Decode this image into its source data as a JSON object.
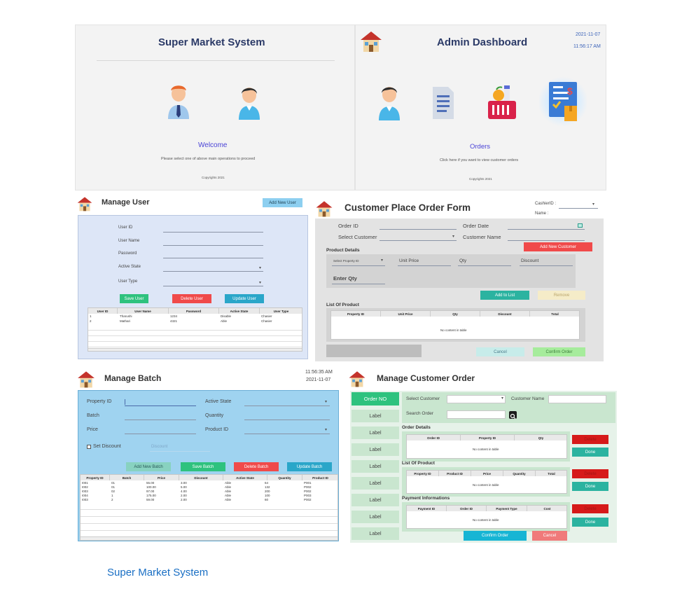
{
  "welcome": {
    "title": "Super Market System",
    "welcome_label": "Welcome",
    "instruction": "Please select one of above main operations to proceed",
    "copyright": "Copyrights 2021"
  },
  "admin": {
    "title": "Admin Dashboard",
    "date": "2021-11-07",
    "time": "11:56:17 AM",
    "orders_label": "Orders",
    "orders_hint": "Click  here if you want to view customer orders",
    "copyright": "Copyrights 2021"
  },
  "manage_user": {
    "title": "Manage User",
    "add_new_user": "Add New User",
    "fields": [
      "User ID",
      "User Name",
      "Password",
      "Active State",
      "User Type"
    ],
    "save": "Save User",
    "delete": "Delete User",
    "update": "Update User",
    "columns": [
      "User ID",
      "User Name",
      "Password",
      "Active State",
      "User Type"
    ],
    "rows": [
      [
        "1",
        "Tharushi",
        "1234",
        "Disable",
        "Chasier"
      ],
      [
        "2",
        "Mathari",
        "4321",
        "Able",
        "Chasier"
      ]
    ]
  },
  "order_form": {
    "title": "Customer Place Order Form",
    "cashier_label": "CashierID :",
    "name_label": "Name   :",
    "order_id": "Order ID",
    "order_date": "Order Date",
    "select_customer": "Select Customer",
    "customer_name": "Customer Name",
    "add_new_customer": "Add New Customer",
    "product_details": "Product Details",
    "select_property": "Select Property ID",
    "unit_price": "Unit Price",
    "qty": "Qty",
    "discount": "Discount",
    "enter_qty": "Enter Qty",
    "add_to_list": "Add to List",
    "remove": "Remove",
    "list_of_product": "List Of Product",
    "columns": [
      "Property ID",
      "Unit Price",
      "Qty",
      "Discount",
      "Total"
    ],
    "empty": "No content in table",
    "cancel": "Cancel",
    "confirm": "Confirm Order"
  },
  "manage_batch": {
    "title": "Manage Batch",
    "time": "11:56:35 AM",
    "date": "2021-11-07",
    "property_id": "Property ID",
    "active_state": "Active State",
    "batch": "Batch",
    "quantity": "Quantity",
    "price": "Price",
    "property_id2": "Product ID",
    "set_discount": "Set Discount",
    "discount_placeholder": "Discount",
    "add_new": "Add New Batch",
    "save": "Save Batch",
    "delete": "Delete Batch",
    "update": "Update Batch",
    "columns": [
      "Property ID",
      "Batch",
      "Price",
      "Discount",
      "Active State",
      "Quantity",
      "Product ID"
    ],
    "rows": [
      [
        "I001",
        "01",
        "55.00",
        "3.00",
        "Able",
        "64",
        "P001"
      ],
      [
        "I002",
        "01",
        "100.00",
        "5.00",
        "Able",
        "132",
        "P002"
      ],
      [
        "I003",
        "02",
        "97.00",
        "4.00",
        "Able",
        "200",
        "P002"
      ],
      [
        "I004",
        "1",
        "175.00",
        "2.00",
        "Able",
        "100",
        "P003"
      ],
      [
        "I003",
        "2",
        "59.00",
        "2.00",
        "Able",
        "60",
        "P002"
      ]
    ]
  },
  "customer_order": {
    "title": "Manage Customer Order",
    "order_no": "Order NO",
    "label": "Label",
    "select_customer": "Select Customer",
    "customer_name": "Customer Name",
    "search_order": "Search Order",
    "order_details": "Order Details",
    "order_columns": [
      "Order ID",
      "Property ID",
      "Qty"
    ],
    "list_of_product": "List Of Product",
    "product_columns": [
      "Property ID",
      "Product ID",
      "Price",
      "Quantity",
      "Total"
    ],
    "payment_info": "Payment Informations",
    "payment_columns": [
      "Payment ID",
      "Order ID",
      "Payment Type",
      "Cost"
    ],
    "empty": "No content in table",
    "delete": "Delete",
    "done": "Done",
    "confirm": "Confirm Order",
    "cancel": "Cancel"
  },
  "caption": "Super Market System",
  "colors": {
    "accent_blue": "#1a6fc4",
    "user_panel": "#dde6f7",
    "batch_panel": "#9fd3f0",
    "order_panel": "#c9e6cf",
    "green_btn": "#2ec27e",
    "red_btn": "#f04a4a",
    "teal_btn": "#2bb3a0",
    "blue_btn": "#2aa6c9"
  }
}
